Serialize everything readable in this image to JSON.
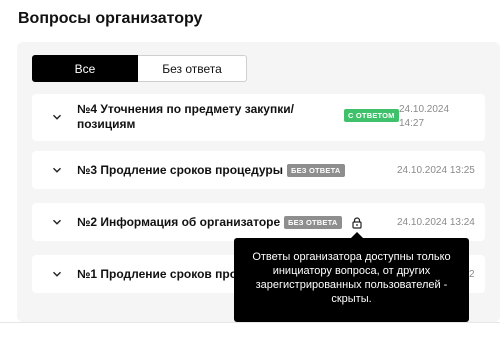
{
  "header": {
    "title": "Вопросы организатору"
  },
  "tabs": [
    {
      "label": "Все",
      "active": true
    },
    {
      "label": "Без ответа",
      "active": false
    }
  ],
  "questions": [
    {
      "title_line1": "№4 Уточнения по предмету закупки/",
      "title_line2": "позициям",
      "badge": "С ОТВЕТОМ",
      "badge_color": "#3fc16b",
      "date_line1": "24.10.2024",
      "date_line2": "14:27"
    },
    {
      "title": "№3 Продление сроков процедуры",
      "badge": "БЕЗ ОТВЕТА",
      "badge_color": "#8e8e8e",
      "date": "24.10.2024 13:25"
    },
    {
      "title": "№2 Информация об организаторе",
      "badge": "БЕЗ ОТВЕТА",
      "badge_color": "#8e8e8e",
      "date": "24.10.2024 13:24",
      "icon": "lock-icon"
    },
    {
      "title": "№1 Продление сроков проце",
      "date_fragment": "2"
    }
  ],
  "tooltip": {
    "text": "Ответы организатора доступны только инициатору вопроса, от других зарегистрированных пользователей - скрыты."
  },
  "colors": {
    "accent": "#000000",
    "panel": "#f5f5f5",
    "badge_green": "#3fc16b",
    "badge_gray": "#8e8e8e"
  }
}
